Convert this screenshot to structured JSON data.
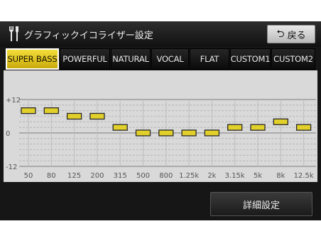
{
  "header": {
    "title": "グラフィックイコライザー設定",
    "back_label": "戻る"
  },
  "tabs": [
    {
      "label": "SUPER BASS",
      "active": true
    },
    {
      "label": "POWERFUL",
      "active": false
    },
    {
      "label": "NATURAL",
      "active": false
    },
    {
      "label": "VOCAL",
      "active": false
    },
    {
      "label": "FLAT",
      "active": false
    },
    {
      "label": "CUSTOM1",
      "active": false
    },
    {
      "label": "CUSTOM2",
      "active": false
    }
  ],
  "equalizer": {
    "y_labels": [
      "+12",
      "0",
      "-12"
    ],
    "range": [
      -12,
      12
    ],
    "bands": [
      {
        "freq": "50",
        "level": 8
      },
      {
        "freq": "80",
        "level": 8
      },
      {
        "freq": "125",
        "level": 6
      },
      {
        "freq": "200",
        "level": 6
      },
      {
        "freq": "315",
        "level": 2
      },
      {
        "freq": "500",
        "level": 0
      },
      {
        "freq": "800",
        "level": 0
      },
      {
        "freq": "1.25k",
        "level": 0
      },
      {
        "freq": "2k",
        "level": 0
      },
      {
        "freq": "3.15k",
        "level": 2
      },
      {
        "freq": "5k",
        "level": 2
      },
      {
        "freq": "8k",
        "level": 4
      },
      {
        "freq": "12.5k",
        "level": 2
      }
    ]
  },
  "detail_button_label": "詳細設定",
  "colors": {
    "active_tab": "#e8cc24",
    "slider_knob": "#e2d02a",
    "panel_bg": "#d9d9d9"
  }
}
